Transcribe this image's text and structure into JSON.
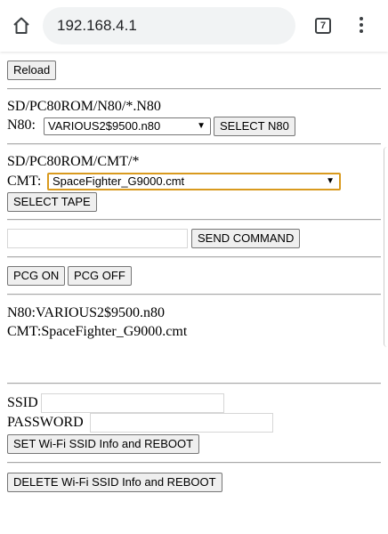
{
  "browser": {
    "url": "192.168.4.1",
    "tab_count": "7"
  },
  "reload_label": "Reload",
  "n80": {
    "path": "SD/PC80ROM/N80/*.N80",
    "label": "N80:",
    "selected": "VARIOUS2$9500.n80",
    "button": "SELECT N80"
  },
  "cmt": {
    "path": "SD/PC80ROM/CMT/*",
    "label": "CMT:",
    "selected": "SpaceFighter_G9000.cmt",
    "button": "SELECT TAPE"
  },
  "command": {
    "value": "",
    "button": "SEND COMMAND"
  },
  "pcg": {
    "on_label": "PCG ON",
    "off_label": "PCG OFF"
  },
  "status": {
    "n80_line": "N80:VARIOUS2$9500.n80",
    "cmt_line": "CMT:SpaceFighter_G9000.cmt"
  },
  "wifi": {
    "ssid_label": "SSID",
    "ssid_value": "",
    "password_label": "PASSWORD",
    "password_value": "",
    "set_button": "SET Wi-Fi SSID Info and REBOOT",
    "delete_button": "DELETE Wi-Fi SSID Info and REBOOT"
  },
  "icons": {
    "home": "home-icon",
    "tabs": "tabs-icon",
    "menu": "more-vert-icon"
  }
}
